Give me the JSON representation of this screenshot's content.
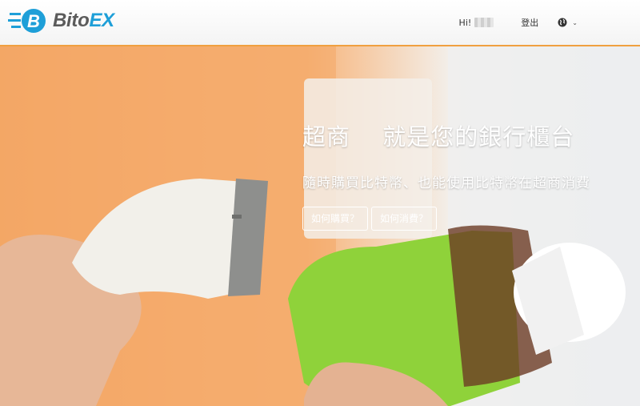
{
  "header": {
    "brand": {
      "part1": "Bito",
      "part2": "EX"
    },
    "greeting": "Hi!",
    "logout": "登出",
    "language_icon": "globe-icon",
    "chevron_icon": "chevron-down-icon"
  },
  "hero": {
    "headline": "超商　 就是您的銀行櫃台",
    "subline": "隨時購買比特幣、也能使用比特幣在超商消費",
    "buttons": [
      {
        "label": "如何購買？"
      },
      {
        "label": "如何消費？"
      }
    ]
  },
  "colors": {
    "accent": "#1e9fd8",
    "brand_gray": "#5b5b5b",
    "header_border": "#f0a040",
    "bottle_green": "#8fd23a"
  }
}
